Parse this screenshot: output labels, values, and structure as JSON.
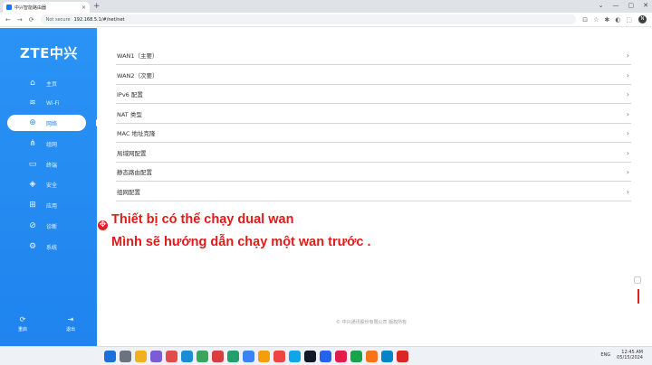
{
  "browser": {
    "tab_title": "中兴智能路由器",
    "tab_close": "×",
    "new_tab": "+",
    "window_controls": [
      "⌄",
      "—",
      "▢",
      "✕"
    ],
    "nav": [
      "←",
      "→",
      "⟳"
    ],
    "security_label": "Not secure",
    "url": "192.168.5.1/#/net/net",
    "ext_icons": [
      "⊡",
      "☆",
      "✱",
      "◐",
      "⬚"
    ],
    "profile_initial": "N"
  },
  "sidebar": {
    "logo": "ZTE中兴",
    "items": [
      {
        "label": "主页",
        "icon": "⌂"
      },
      {
        "label": "Wi-Fi",
        "icon": "≋"
      },
      {
        "label": "网络",
        "icon": "⊕"
      },
      {
        "label": "组网",
        "icon": "⋔"
      },
      {
        "label": "终端",
        "icon": "▭"
      },
      {
        "label": "安全",
        "icon": "◈"
      },
      {
        "label": "应用",
        "icon": "⊞"
      },
      {
        "label": "诊断",
        "icon": "⊘"
      },
      {
        "label": "系统",
        "icon": "⚙"
      }
    ],
    "active_index": 2,
    "bottom": [
      {
        "label": "重启",
        "icon": "⟳"
      },
      {
        "label": "退出",
        "icon": "⇥"
      }
    ]
  },
  "main": {
    "rows": [
      "WAN1（主要）",
      "WAN2（次要）",
      "IPv6 配置",
      "NAT 类型",
      "MAC 地址克隆",
      "局域网配置",
      "静态路由配置",
      "组网配置"
    ],
    "chevron": "›",
    "footer": "© 中兴通讯股份有限公司 版权所有"
  },
  "captions": {
    "icon": "✥",
    "line1": "Thiết bị có thể chạy dual wan",
    "line2": "Mình sẽ hướng dẫn chạy một wan trước ."
  },
  "taskbar": {
    "tray_text": "ENG",
    "time": "12:45 AM",
    "date": "05/15/2024"
  },
  "colors": {
    "sidebar": "#1f84ee",
    "caption": "#e11a1a"
  }
}
